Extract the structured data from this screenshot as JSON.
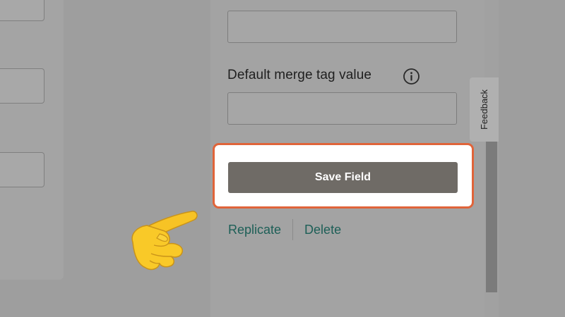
{
  "form": {
    "default_merge_label": "Default merge tag value",
    "save_button_label": "Save Field",
    "replicate_link": "Replicate",
    "delete_link": "Delete"
  },
  "feedback_tab": "Feedback",
  "colors": {
    "highlight_border": "#e0643a",
    "save_button_bg": "#6f6b66",
    "link_color": "#1d5f57"
  },
  "icons": {
    "info": "info-icon",
    "pointer": "pointing-hand-icon"
  }
}
